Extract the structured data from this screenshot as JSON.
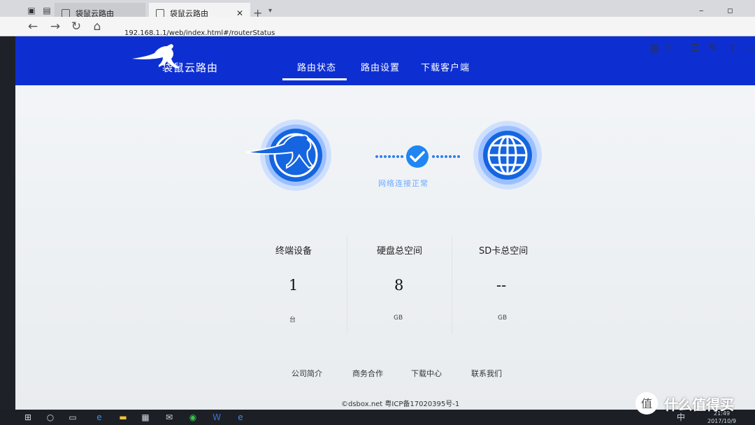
{
  "browser": {
    "tabs": [
      {
        "title": "袋鼠云路由",
        "active": false
      },
      {
        "title": "袋鼠云路由",
        "active": true
      }
    ],
    "new_tab_label": "+",
    "address": "192.168.1.1/web/index.html#/routerStatus"
  },
  "site": {
    "logo_text": "袋鼠云路由",
    "menu": [
      {
        "label": "路由状态",
        "active": true
      },
      {
        "label": "路由设置",
        "active": false
      },
      {
        "label": "下载客户端",
        "active": false
      }
    ]
  },
  "status": {
    "connection_text": "网络连接正常"
  },
  "stats": [
    {
      "label": "终端设备",
      "value": "1",
      "unit": "台"
    },
    {
      "label": "硬盘总空间",
      "value": "8",
      "unit": "GB"
    },
    {
      "label": "SD卡总空间",
      "value": "--",
      "unit": "GB"
    }
  ],
  "footer": {
    "links": [
      "公司简介",
      "商务合作",
      "下载中心",
      "联系我们"
    ],
    "copyright": "©dsbox.net 粤ICP备17020395号-1"
  },
  "taskbar": {
    "ime": "中",
    "time": "21:49",
    "date": "2017/10/9"
  },
  "watermark": {
    "text": "什么值得买",
    "badge": "值"
  },
  "colors": {
    "header_blue": "#0d2fd2",
    "accent_blue": "#1565e0",
    "status_text": "#6aa8ff"
  }
}
